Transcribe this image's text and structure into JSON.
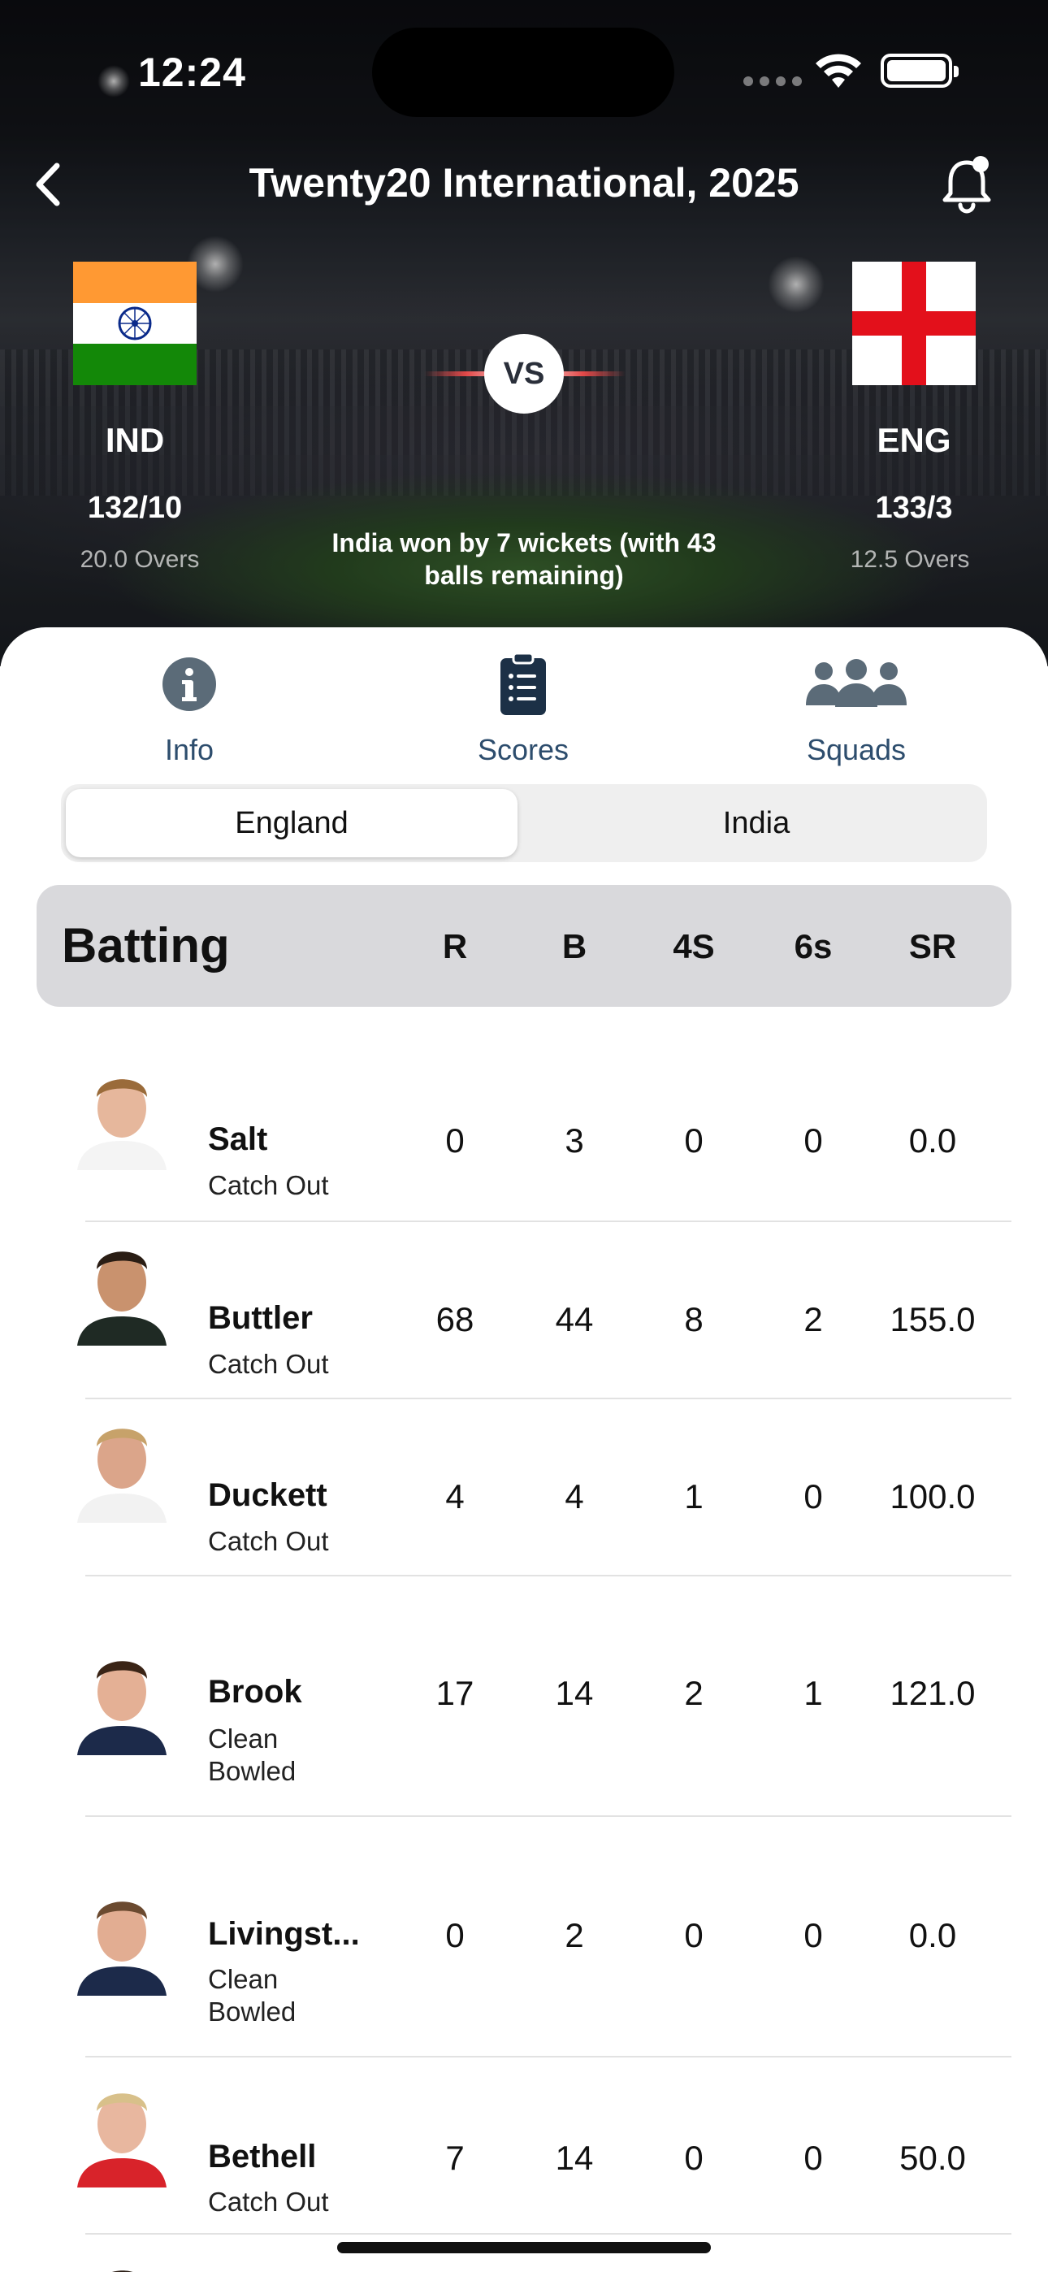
{
  "status_bar": {
    "time": "12:24"
  },
  "header": {
    "title": "Twenty20 International, 2025"
  },
  "match": {
    "vs_label": "VS",
    "team1": {
      "code": "IND",
      "score": "132/10",
      "overs": "20.0 Overs"
    },
    "team2": {
      "code": "ENG",
      "score": "133/3",
      "overs": "12.5 Overs"
    },
    "result": "India won by 7 wickets (with 43 balls remaining)"
  },
  "tabs": [
    {
      "label": "Info",
      "icon": "info-icon"
    },
    {
      "label": "Scores",
      "icon": "clipboard-icon"
    },
    {
      "label": "Squads",
      "icon": "group-icon"
    }
  ],
  "team_toggle": {
    "selected": "England",
    "other": "India"
  },
  "batting": {
    "title": "Batting",
    "columns": [
      "R",
      "B",
      "4S",
      "6s",
      "SR"
    ],
    "rows": [
      {
        "name": "Salt",
        "dismissal": "Catch Out",
        "r": "0",
        "b": "3",
        "fours": "0",
        "sixes": "0",
        "sr": "0.0"
      },
      {
        "name": "Buttler",
        "dismissal": "Catch Out",
        "r": "68",
        "b": "44",
        "fours": "8",
        "sixes": "2",
        "sr": "155.0"
      },
      {
        "name": "Duckett",
        "dismissal": "Catch Out",
        "r": "4",
        "b": "4",
        "fours": "1",
        "sixes": "0",
        "sr": "100.0"
      },
      {
        "name": "Brook",
        "dismissal": "Clean Bowled",
        "r": "17",
        "b": "14",
        "fours": "2",
        "sixes": "1",
        "sr": "121.0"
      },
      {
        "name": "Livingst...",
        "dismissal": "Clean Bowled",
        "r": "0",
        "b": "2",
        "fours": "0",
        "sixes": "0",
        "sr": "0.0"
      },
      {
        "name": "Bethell",
        "dismissal": "Catch Out",
        "r": "7",
        "b": "14",
        "fours": "0",
        "sixes": "0",
        "sr": "50.0"
      }
    ]
  },
  "colors": {
    "accent": "#2d4d6d",
    "icon_grey": "#5b6b78",
    "flag_saffron": "#ff9933",
    "flag_green": "#138808",
    "flag_red": "#e3101b"
  }
}
